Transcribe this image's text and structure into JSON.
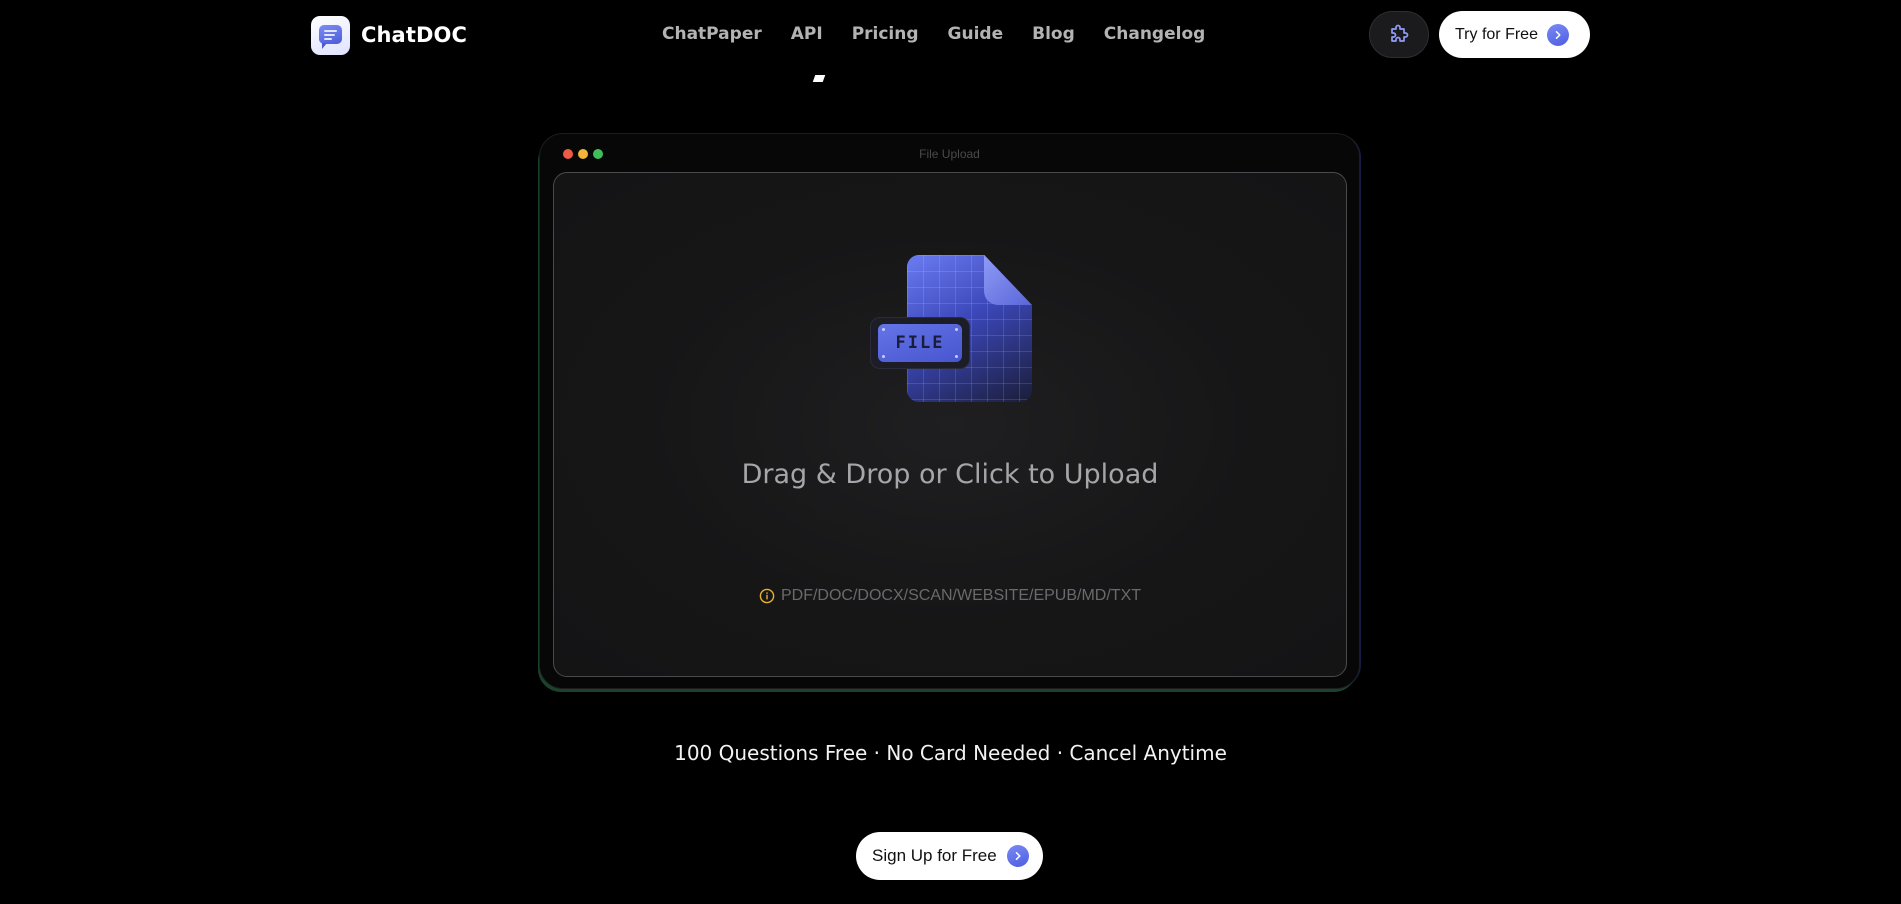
{
  "brand": {
    "name": "ChatDOC"
  },
  "nav": {
    "items": [
      {
        "label": "ChatPaper"
      },
      {
        "label": "API"
      },
      {
        "label": "Pricing"
      },
      {
        "label": "Guide"
      },
      {
        "label": "Blog"
      },
      {
        "label": "Changelog"
      }
    ]
  },
  "header": {
    "extension_icon": "puzzle-icon",
    "try_label": "Try for Free"
  },
  "upload": {
    "window_title": "File Upload",
    "file_badge": "FILE",
    "prompt": "Drag & Drop or Click to Upload",
    "formats": "PDF/DOC/DOCX/SCAN/WEBSITE/EPUB/MD/TXT",
    "info_icon": "info-icon"
  },
  "hero": {
    "tagline": "100 Questions Free · No Card Needed · Cancel Anytime",
    "signup_label": "Sign Up for Free"
  },
  "colors": {
    "accent": "#5b6be6",
    "info": "#e8b22e",
    "dot_red": "#ef5a45",
    "dot_yellow": "#f2b43b",
    "dot_green": "#3fbf5a"
  }
}
